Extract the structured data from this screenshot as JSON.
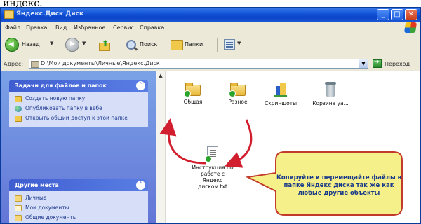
{
  "page": {
    "title": "индекс."
  },
  "window": {
    "title": "Яндекс.Диск Диск",
    "controls": {
      "minimize": "_",
      "maximize": "□",
      "close": "✕"
    }
  },
  "menu": {
    "items": [
      {
        "label": "Файл"
      },
      {
        "label": "Правка"
      },
      {
        "label": "Вид"
      },
      {
        "label": "Избранное"
      },
      {
        "label": "Сервис"
      },
      {
        "label": "Справка"
      }
    ]
  },
  "toolbar": {
    "back_label": "Назад",
    "search_label": "Поиск",
    "folders_label": "Папки",
    "dropdown_glyph": "▼"
  },
  "address": {
    "label": "Адрес:",
    "value": "D:\\Мои документы\\Личные\\Яндекс.Диск",
    "go_label": "Переход"
  },
  "taskpane": {
    "file_tasks": {
      "title": "Задачи для файлов и папок",
      "items": [
        {
          "label": "Создать новую папку",
          "icon": "new-folder-icon"
        },
        {
          "label": "Опубликовать папку в вебе",
          "icon": "globe-icon"
        },
        {
          "label": "Открыть общий доступ к этой папке",
          "icon": "share-folder-icon"
        }
      ]
    },
    "other_places": {
      "title": "Другие места",
      "items": [
        {
          "label": "Личные",
          "icon": "folder-icon"
        },
        {
          "label": "Мои документы",
          "icon": "documents-icon"
        },
        {
          "label": "Общие документы",
          "icon": "folder-icon"
        }
      ]
    },
    "chevron_glyph": "˄"
  },
  "files": [
    {
      "label": "Общая",
      "kind": "shared-folder"
    },
    {
      "label": "Разное",
      "kind": "shared-folder"
    },
    {
      "label": "Скриншоты",
      "kind": "app-folder"
    },
    {
      "label": "Корзина уа...",
      "kind": "recycle-bin"
    }
  ],
  "text_file": {
    "lines": [
      "Инструкция по",
      "работе с",
      "Яндекс",
      "диском.txt"
    ]
  },
  "callout": {
    "text": "Копируйте и перемещайте файлы в папке Яндекс диска так же как любые другие объекты"
  },
  "colors": {
    "callout_fill": "#f6f08a",
    "callout_border": "#c23a2a",
    "arrow": "#d21f2f",
    "task_header": "#3e5dd0"
  }
}
